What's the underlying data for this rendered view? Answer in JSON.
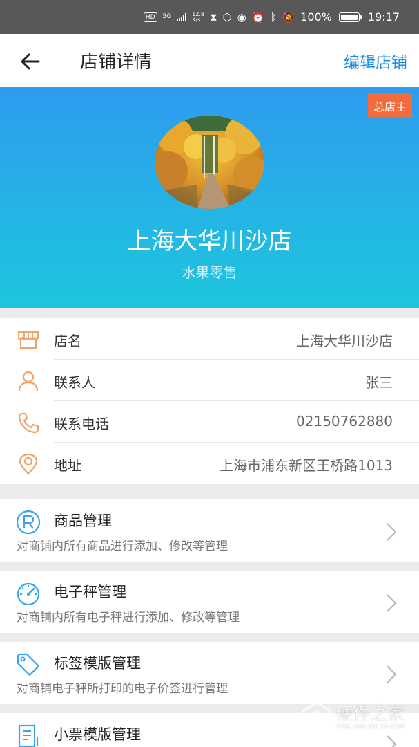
{
  "status_bar": {
    "hd": "HD",
    "signal": "5G",
    "net_speed_value": "12.8",
    "net_speed_unit": "K/s",
    "battery": "100%",
    "time": "19:17"
  },
  "toolbar": {
    "title": "店铺详情",
    "edit_label": "编辑店铺"
  },
  "store": {
    "owner_tag": "总店主",
    "name": "上海大华川沙店",
    "type": "水果零售"
  },
  "info_rows": [
    {
      "icon": "store-icon",
      "label": "店名",
      "value": "上海大华川沙店"
    },
    {
      "icon": "person-icon",
      "label": "联系人",
      "value": "张三"
    },
    {
      "icon": "phone-icon",
      "label": "联系电话",
      "value": "02150762880"
    },
    {
      "icon": "location-pin-icon",
      "label": "地址",
      "value": "上海市浦东新区王桥路1013"
    }
  ],
  "menu": [
    {
      "icon": "registered-r-icon",
      "title": "商品管理",
      "desc": "对商铺内所有商品进行添加、修改等管理"
    },
    {
      "icon": "gauge-icon",
      "title": "电子秤管理",
      "desc": "对商铺内所有电子秤进行添加、修改等管理"
    },
    {
      "icon": "tag-icon",
      "title": "标签模版管理",
      "desc": "对商铺电子秤所打印的电子价签进行管理"
    },
    {
      "icon": "receipt-icon",
      "title": "小票模版管理",
      "desc": ""
    }
  ],
  "watermark": {
    "name": "硬件之家",
    "sub": "YING JIAN ZHI JIA.COM"
  },
  "colors": {
    "accent": "#1b8be0",
    "icon_orange": "#f0a36a",
    "icon_blue": "#3aa4ee",
    "owner_tag": "#f26b3a",
    "banner_top": "#2e9bee",
    "banner_bottom": "#1cc6dc"
  }
}
